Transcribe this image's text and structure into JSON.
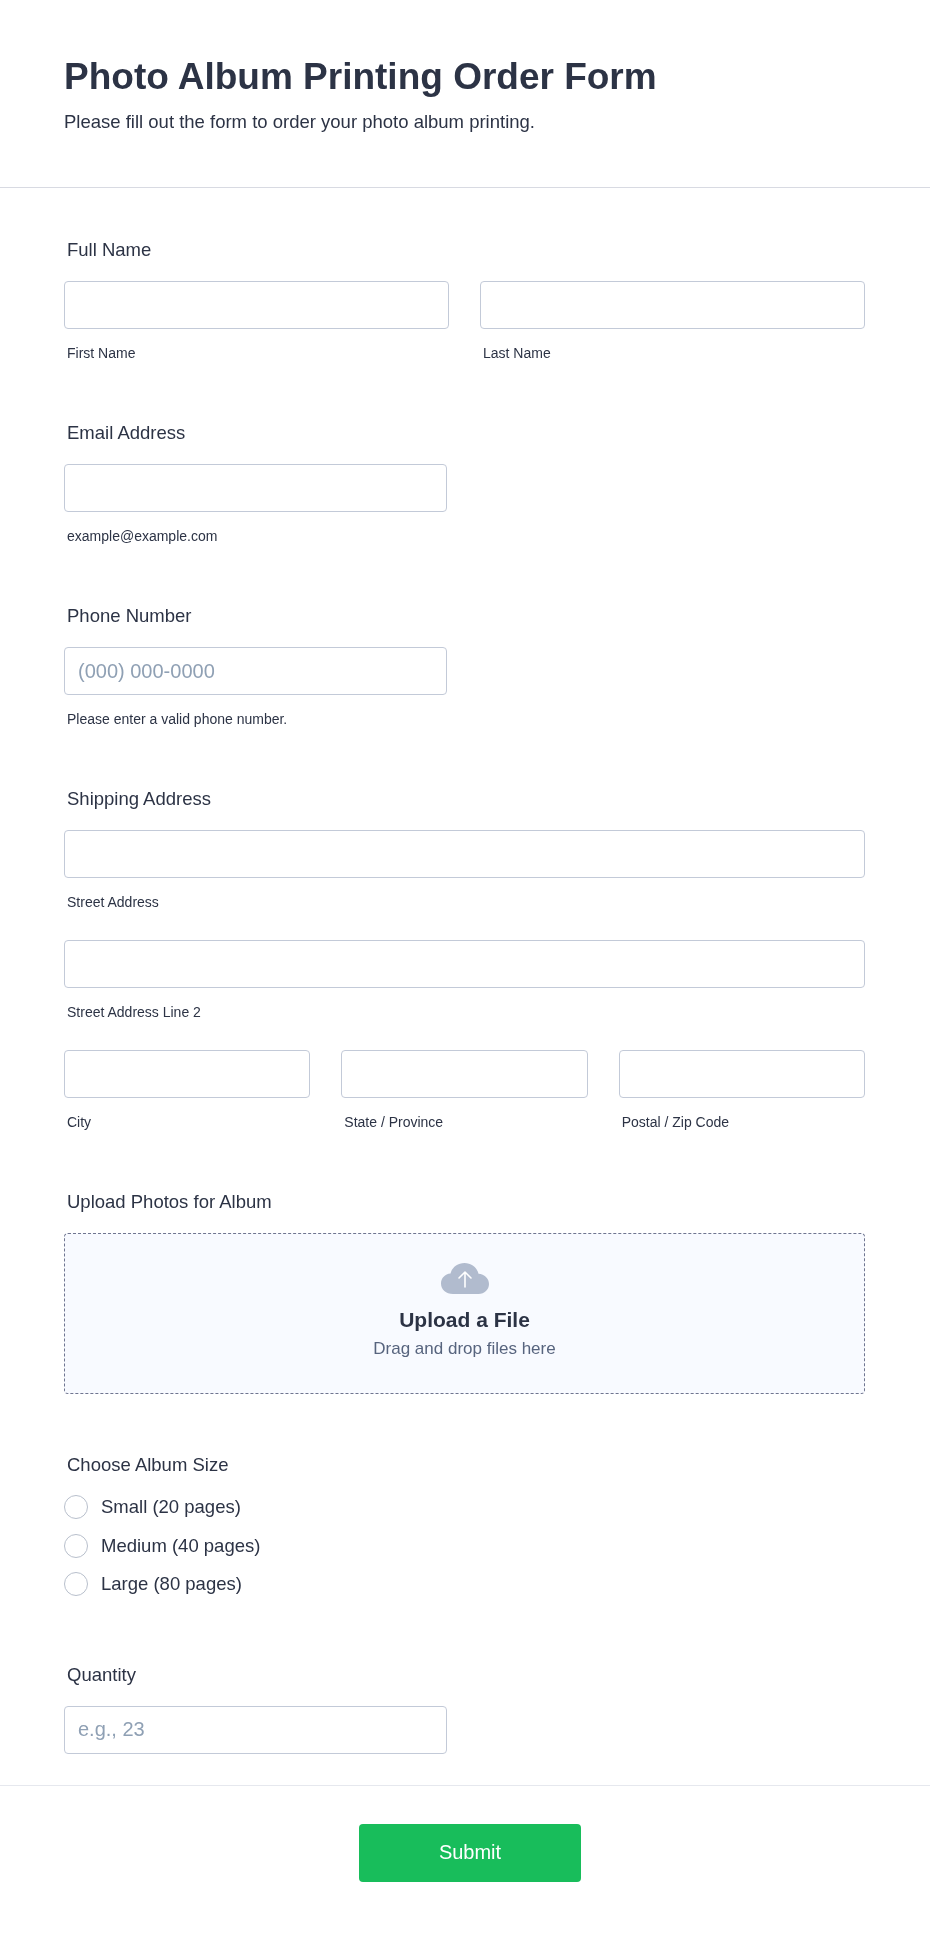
{
  "header": {
    "title": "Photo Album Printing Order Form",
    "subtitle": "Please fill out the form to order your photo album printing."
  },
  "fields": [
    {
      "kind": "name",
      "label": "Full Name",
      "inputs": [
        {
          "sublabel": "First Name"
        },
        {
          "sublabel": "Last Name"
        }
      ]
    },
    {
      "kind": "short",
      "label": "Email Address",
      "inputs": [
        {
          "sublabel": "example@example.com"
        }
      ]
    },
    {
      "kind": "short",
      "label": "Phone Number",
      "inputs": [
        {
          "placeholder": "(000) 000-0000",
          "sublabel": "Please enter a valid phone number."
        }
      ]
    },
    {
      "kind": "address",
      "label": "Shipping Address",
      "rows": [
        [
          {
            "sublabel": "Street Address"
          }
        ],
        [
          {
            "sublabel": "Street Address Line 2"
          }
        ],
        [
          {
            "sublabel": "City"
          },
          {
            "sublabel": "State / Province"
          },
          {
            "sublabel": "Postal / Zip Code"
          }
        ]
      ]
    },
    {
      "kind": "upload",
      "label": "Upload Photos for Album",
      "title": "Upload a File",
      "hint": "Drag and drop files here"
    },
    {
      "kind": "choice",
      "label": "Choose Album Size",
      "options": [
        {
          "label": "Small (20 pages)",
          "selected": false
        },
        {
          "label": "Medium (40 pages)",
          "selected": false
        },
        {
          "label": "Large (80 pages)",
          "selected": false
        }
      ]
    },
    {
      "kind": "short",
      "label": "Quantity",
      "inputs": [
        {
          "placeholder": "e.g., 23"
        }
      ]
    }
  ],
  "submit": {
    "label": "Submit"
  }
}
